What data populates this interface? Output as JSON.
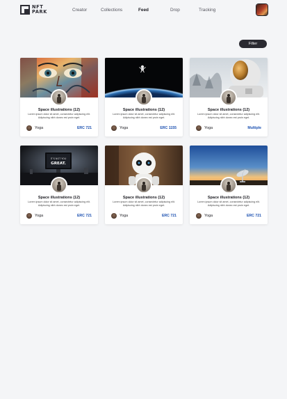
{
  "brand": {
    "line1": "NFT",
    "line2": "PARK"
  },
  "nav": [
    "Creator",
    "Collections",
    "Feed",
    "Drop",
    "Tracking"
  ],
  "nav_active": "Feed",
  "filter_label": "Filter",
  "cards": [
    {
      "title": "Space illustrations  (12)",
      "desc": "Lorem ipsum dolor sit amet, consectetur adipiscing elit. Adipiscing nibh donec est proin eget.",
      "owner": "Yoga",
      "tag": "ERC 721",
      "image": "graffiti-face-art"
    },
    {
      "title": "Space illustrations  (12)",
      "desc": "Lorem ipsum dolor sit amet, consectetur adipiscing elit. Adipiscing nibh donec est proin eget.",
      "owner": "Yoga",
      "tag": "ERC 1155",
      "image": "astronaut-over-earth"
    },
    {
      "title": "Space illustrations  (12)",
      "desc": "Lorem ipsum dolor sit amet, consectetur adipiscing elit. Adipiscing nibh donec est proin eget.",
      "owner": "Yoga",
      "tag": "Multiple",
      "image": "astronaut-helmet-snow"
    },
    {
      "title": "Space illustrations  (12)",
      "desc": "Lorem ipsum dolor sit amet, consectetur adipiscing elit. Adipiscing nibh donec est proin eget.",
      "owner": "Yoga",
      "tag": "ERC 721",
      "image": "desk-monitor-quote",
      "image_text": "IT'S NOT YOU\nGREAT."
    },
    {
      "title": "Space illustrations  (12)",
      "desc": "Lorem ipsum dolor sit amet, consectetur adipiscing elit. Adipiscing nibh donec est proin eget.",
      "owner": "Yoga",
      "tag": "ERC 721",
      "image": "white-robot"
    },
    {
      "title": "Space illustrations  (12)",
      "desc": "Lorem ipsum dolor sit amet, consectetur adipiscing elit. Adipiscing nibh donec est proin eget.",
      "owner": "Yoga",
      "tag": "ERC 721",
      "image": "radio-telescope-sky"
    }
  ],
  "colors": {
    "accent": "#1a4fb0",
    "button": "#2a2a31",
    "background": "#f4f5f7"
  }
}
